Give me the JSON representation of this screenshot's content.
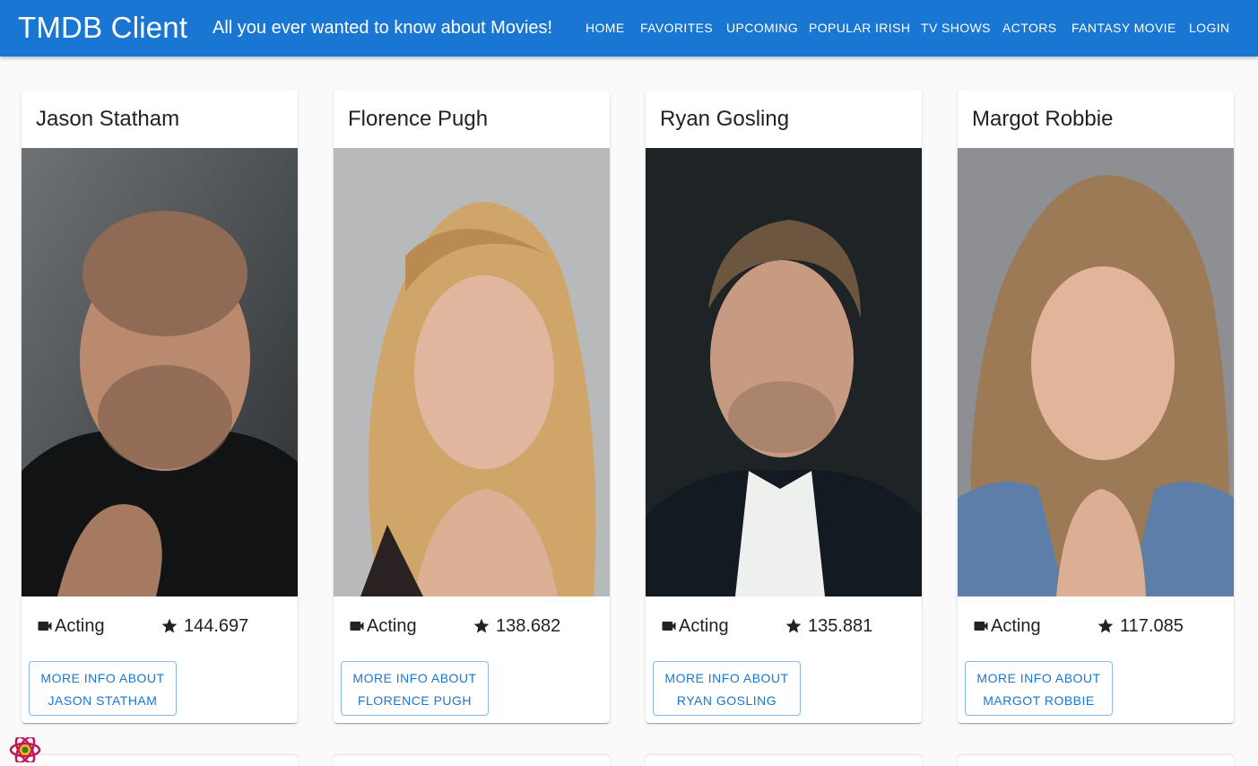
{
  "header": {
    "brand": "TMDB Client",
    "tagline": "All you ever wanted to know about Movies!",
    "nav": [
      {
        "label": "HOME"
      },
      {
        "label": "FAVORITES"
      },
      {
        "label": "UPCOMING"
      },
      {
        "label": "POPULAR IRISH"
      },
      {
        "label": "TV SHOWS"
      },
      {
        "label": "ACTORS"
      },
      {
        "label": "FANTASY MOVIE"
      },
      {
        "label": "LOGIN"
      }
    ]
  },
  "colors": {
    "appbar": "#1976d2",
    "accent": "#1976d2"
  },
  "actors": [
    {
      "name": "Jason Statham",
      "department": "Acting",
      "popularity": "144.697",
      "more_line1": "MORE INFO ABOUT",
      "more_line2": "JASON STATHAM"
    },
    {
      "name": "Florence Pugh",
      "department": "Acting",
      "popularity": "138.682",
      "more_line1": "MORE INFO ABOUT",
      "more_line2": "FLORENCE PUGH"
    },
    {
      "name": "Ryan Gosling",
      "department": "Acting",
      "popularity": "135.881",
      "more_line1": "MORE INFO ABOUT",
      "more_line2": "RYAN GOSLING"
    },
    {
      "name": "Margot Robbie",
      "department": "Acting",
      "popularity": "117.085",
      "more_line1": "MORE INFO ABOUT",
      "more_line2": "MARGOT ROBBIE"
    }
  ]
}
